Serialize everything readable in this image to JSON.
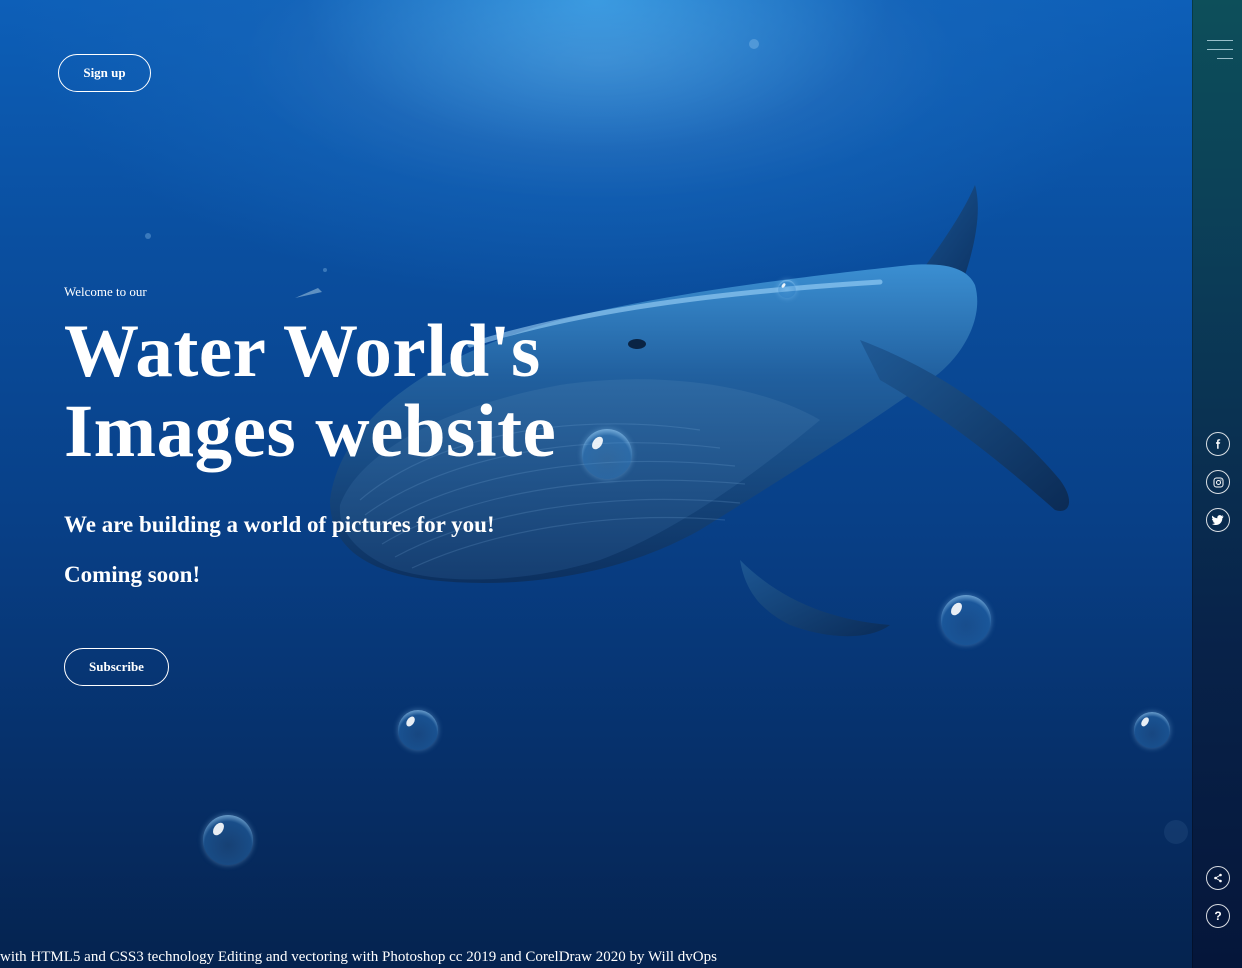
{
  "header": {
    "signup_label": "Sign up"
  },
  "hero": {
    "welcome": "Welcome to our",
    "title_line1": "Water World's",
    "title_line2": "Images website",
    "tagline": "We are building a world of pictures for you!",
    "coming_soon": "Coming soon!",
    "subscribe_label": "Subscribe"
  },
  "side_rail": {
    "menu_icon": "hamburger-menu-icon",
    "social_icons": [
      "facebook-icon",
      "instagram-icon",
      "twitter-icon"
    ],
    "share_icon": "share-icon",
    "help_icon": "help-icon",
    "help_glyph": "?"
  },
  "footer": {
    "credit": "with HTML5 and CSS3 technology Editing and vectoring with Photoshop cc 2019 and CorelDraw 2020 by Will dvOps"
  },
  "colors": {
    "ocean_top": "#2e96e1",
    "ocean_bottom": "#05234f",
    "rail_top": "#0d4f5a",
    "rail_bottom": "#05163a",
    "text": "#ffffff"
  }
}
